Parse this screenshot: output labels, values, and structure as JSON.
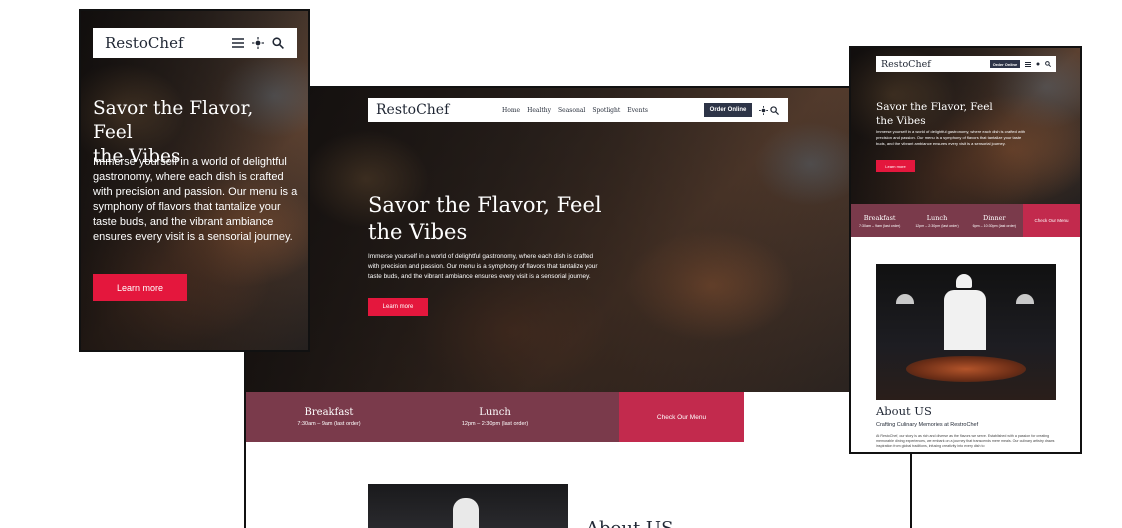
{
  "brand": {
    "name": "RestoChef"
  },
  "colors": {
    "primary": "#e4173d",
    "meal_bar": "#7a3a4b",
    "menu_btn": "#c22a4d",
    "nav_dark": "#2d3447"
  },
  "nav": {
    "links": [
      "Home",
      "Healthy",
      "Seasonal",
      "Spotlight",
      "Events"
    ],
    "order_label": "Order Online",
    "icons": [
      "menu-icon",
      "sun-icon",
      "search-icon"
    ]
  },
  "hero": {
    "title_line1": "Savor the Flavor, Feel",
    "title_line2": "the Vibes",
    "body": "Immerse yourself in a world of delightful gastronomy, where each dish is crafted with precision and passion. Our menu is a symphony of flavors that tantalize your taste buds, and the vibrant ambiance ensures every visit is a sensorial journey.",
    "cta": "Learn more"
  },
  "meals": [
    {
      "name": "Breakfast",
      "time": "7:30am – 9am (last order)"
    },
    {
      "name": "Lunch",
      "time": "12pm – 2:30pm (last order)"
    },
    {
      "name": "Dinner",
      "time": "6pm – 10:30pm (last order)"
    }
  ],
  "menu_cta": "Check Our Menu",
  "about": {
    "title": "About US",
    "subtitle": "Crafting Culinary Memories at RestroChef",
    "body": "At RestoChef, our story is as rich and diverse as the flavors we serve. Established with a passion for creating memorable dining experiences, we embark on a journey that transcends mere meals. Our culinary artistry draws inspiration from global traditions, infusing creativity into every dish to",
    "desktop_peek": "About US"
  }
}
